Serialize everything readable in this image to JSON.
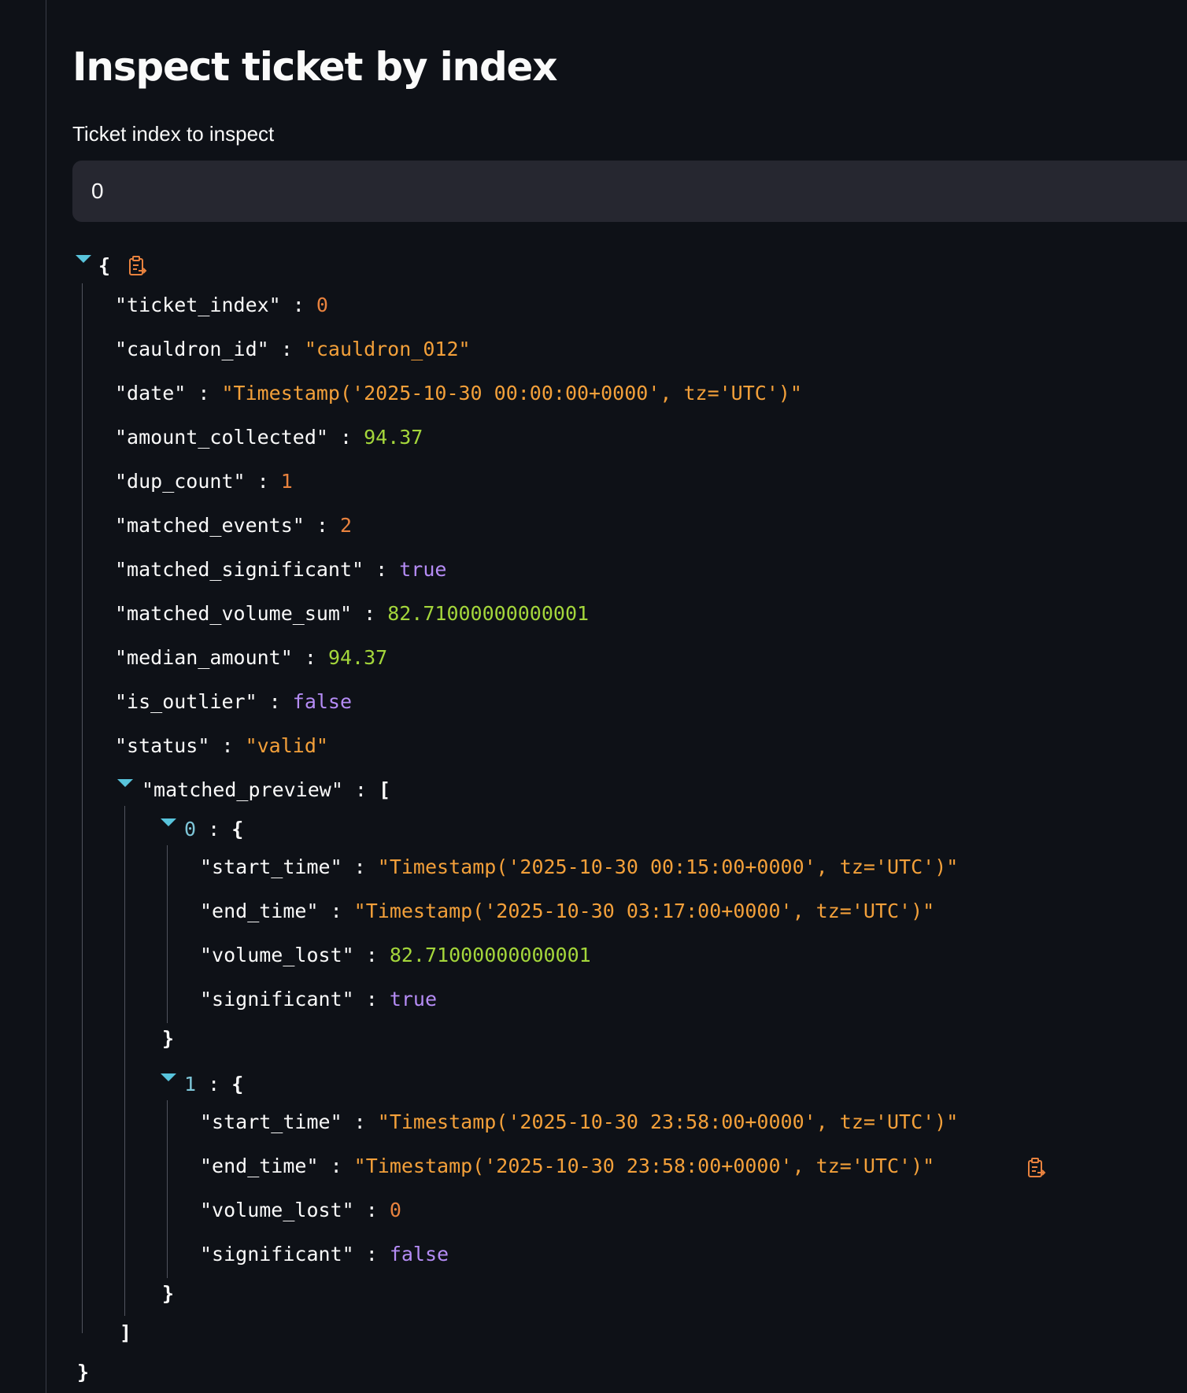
{
  "page": {
    "title": "Inspect ticket by index"
  },
  "index_input": {
    "label": "Ticket index to inspect",
    "value": "0"
  },
  "json": {
    "open_brace": "{",
    "close_brace": "}",
    "fields": [
      {
        "key": "\"ticket_index\"",
        "value": "0"
      },
      {
        "key": "\"cauldron_id\"",
        "value": "\"cauldron_012\""
      },
      {
        "key": "\"date\"",
        "value": "\"Timestamp('2025-10-30 00:00:00+0000', tz='UTC')\""
      },
      {
        "key": "\"amount_collected\"",
        "value": "94.37"
      },
      {
        "key": "\"dup_count\"",
        "value": "1"
      },
      {
        "key": "\"matched_events\"",
        "value": "2"
      },
      {
        "key": "\"matched_significant\"",
        "value": "true"
      },
      {
        "key": "\"matched_volume_sum\"",
        "value": "82.71000000000001"
      },
      {
        "key": "\"median_amount\"",
        "value": "94.37"
      },
      {
        "key": "\"is_outlier\"",
        "value": "false"
      },
      {
        "key": "\"status\"",
        "value": "\"valid\""
      }
    ],
    "matched_preview": {
      "key": "\"matched_preview\"",
      "open_bracket": "[",
      "close_bracket": "]",
      "items": [
        {
          "index": "0",
          "open_brace": "{",
          "close_brace": "}",
          "fields": [
            {
              "key": "\"start_time\"",
              "value": "\"Timestamp('2025-10-30 00:15:00+0000', tz='UTC')\""
            },
            {
              "key": "\"end_time\"",
              "value": "\"Timestamp('2025-10-30 03:17:00+0000', tz='UTC')\""
            },
            {
              "key": "\"volume_lost\"",
              "value": "82.71000000000001"
            },
            {
              "key": "\"significant\"",
              "value": "true"
            }
          ]
        },
        {
          "index": "1",
          "open_brace": "{",
          "close_brace": "}",
          "fields": [
            {
              "key": "\"start_time\"",
              "value": "\"Timestamp('2025-10-30 23:58:00+0000', tz='UTC')\""
            },
            {
              "key": "\"end_time\"",
              "value": "\"Timestamp('2025-10-30 23:58:00+0000', tz='UTC')\""
            },
            {
              "key": "\"volume_lost\"",
              "value": "0"
            },
            {
              "key": "\"significant\"",
              "value": "false"
            }
          ]
        }
      ]
    }
  },
  "icons": {
    "collapse": "caret-down-icon",
    "copy": "clipboard-copy-icon"
  },
  "colors": {
    "background": "#0e1117",
    "input_background": "#262730",
    "integer": "#e8823e",
    "string": "#f3a03a",
    "float": "#a4d63b",
    "boolean": "#b58cf5",
    "caret": "#58c4dc"
  }
}
